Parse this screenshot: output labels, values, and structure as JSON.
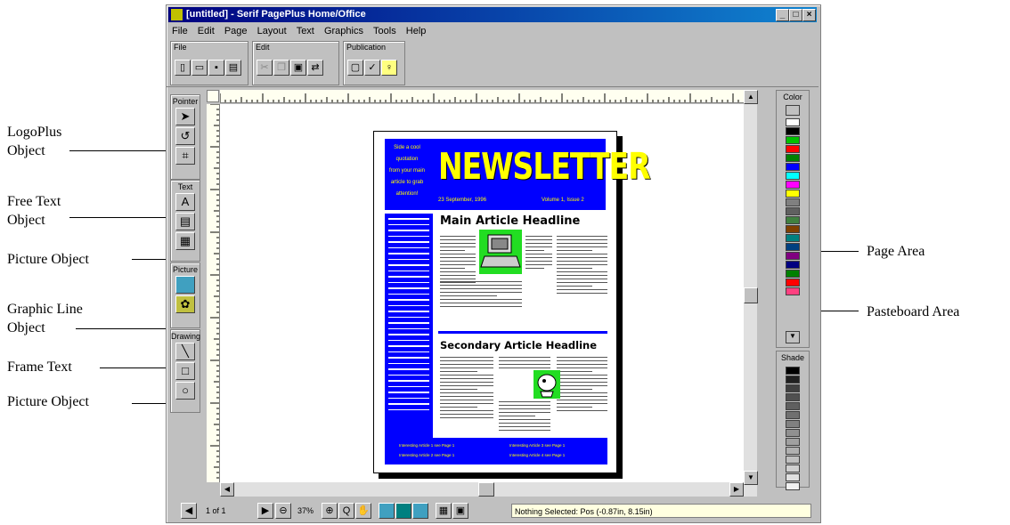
{
  "callouts": {
    "logoplus": [
      "LogoPlus",
      "Object"
    ],
    "free_text": [
      "Free Text",
      "Object"
    ],
    "picture1": "Picture Object",
    "graphic_line": [
      "Graphic Line",
      "Object"
    ],
    "frame_text": "Frame Text",
    "picture2": "Picture Object",
    "page_area": "Page Area",
    "pasteboard_area": "Pasteboard Area"
  },
  "window": {
    "title": "[untitled] - Serif PagePlus Home/Office",
    "menu": [
      "File",
      "Edit",
      "Page",
      "Layout",
      "Text",
      "Graphics",
      "Tools",
      "Help"
    ]
  },
  "toolbars": {
    "file_label": "File",
    "edit_label": "Edit",
    "publication_label": "Publication"
  },
  "toolbox": {
    "pointer_label": "Pointer",
    "text_label": "Text",
    "picture_label": "Picture",
    "drawing_label": "Drawing"
  },
  "panels": {
    "color_label": "Color",
    "shade_label": "Shade",
    "colors": [
      "#ffffff",
      "#000000",
      "#00c000",
      "#ff0000",
      "#008000",
      "#0000ff",
      "#00ffff",
      "#ff00ff",
      "#ffff00",
      "#808080",
      "#606060",
      "#408040",
      "#804000",
      "#008080",
      "#004080",
      "#800080",
      "#000080",
      "#008000",
      "#ff0000",
      "#ff4080"
    ],
    "shades": [
      "#000000",
      "#202020",
      "#404040",
      "#505050",
      "#606060",
      "#707070",
      "#808080",
      "#909090",
      "#a0a0a0",
      "#b0b0b0",
      "#c0c0c0",
      "#d0d0d0",
      "#e0e0e0",
      "#f0f0f0"
    ]
  },
  "status": {
    "page_indicator": "1 of 1",
    "zoom": "37%",
    "message": "Nothing Selected: Pos (-0.87in, 8.15in)"
  },
  "newsletter": {
    "title": "NEWSLETTER",
    "side_text": [
      "Side a cool",
      "quotation",
      "from your main",
      "article to grab",
      "attention!"
    ],
    "date": "23 September, 1996",
    "volume": "Volume 1, Issue 2",
    "main_headline": "Main Article Headline",
    "secondary_headline": "Secondary Article Headline",
    "footer_items": [
      "Interesting Article 1 see Page 1",
      "Interesting Article 3 see Page 1",
      "Interesting Article 2 see Page 1",
      "Interesting Article 4 see Page 1"
    ]
  }
}
